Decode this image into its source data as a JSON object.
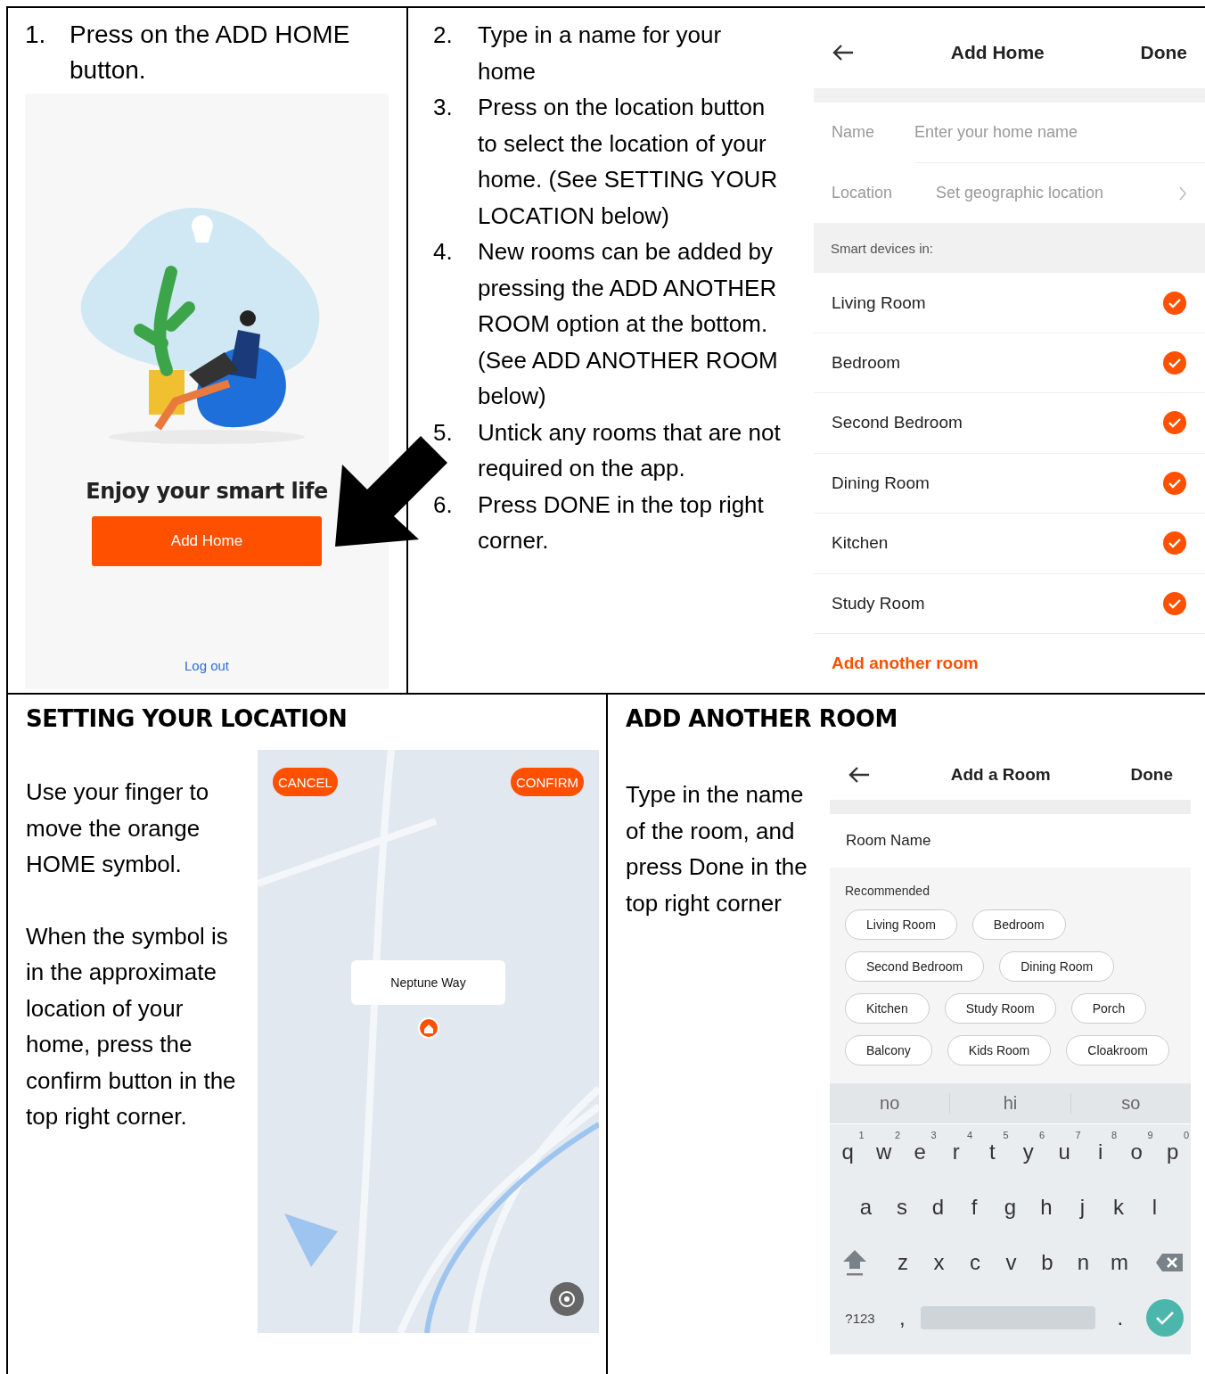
{
  "add_home_panel": {
    "step": {
      "number": "1.",
      "text": "Press on the ADD HOME button."
    },
    "screen": {
      "headline": "Enjoy your smart life",
      "button": "Add Home",
      "link": "Log out"
    }
  },
  "steps": [
    {
      "number": "2.",
      "text": "Type in a name for your home"
    },
    {
      "number": "3.",
      "text": "Press on the location button to select the location of your home.  (See SETTING YOUR LOCATION below)"
    },
    {
      "number": "4.",
      "text": "New rooms can be added by pressing the ADD ANOTHER ROOM option at the bottom. (See ADD ANOTHER ROOM below)"
    },
    {
      "number": "5.",
      "text": "Untick any rooms that are not required on the app."
    },
    {
      "number": "6.",
      "text": "Press DONE in the top right corner."
    }
  ],
  "add_home_screen": {
    "title": "Add Home",
    "action": "Done",
    "name_field": {
      "label": "Name",
      "placeholder": "Enter your home name"
    },
    "location_field": {
      "label": "Location",
      "value": "Set geographic location"
    },
    "section": "Smart devices in:",
    "rooms": [
      {
        "name": "Living Room",
        "checked": true
      },
      {
        "name": "Bedroom",
        "checked": true
      },
      {
        "name": "Second Bedroom",
        "checked": true
      },
      {
        "name": "Dining Room",
        "checked": true
      },
      {
        "name": "Kitchen",
        "checked": true
      },
      {
        "name": "Study Room",
        "checked": true
      }
    ],
    "add_link": "Add another room"
  },
  "location_section": {
    "heading": "SETTING YOUR LOCATION",
    "paragraphs": [
      "Use your finger to move the orange HOME symbol.",
      "When the symbol is in the approximate location of your home, press the confirm button in the top right corner."
    ],
    "map": {
      "cancel": "CANCEL",
      "confirm": "CONFIRM",
      "callout": "Neptune Way"
    }
  },
  "room_section": {
    "heading": "ADD ANOTHER ROOM",
    "paragraph": "Type in the name of the room, and press Done in the top right corner",
    "screen": {
      "title": "Add a Room",
      "action": "Done",
      "placeholder": "Room Name",
      "recommended_label": "Recommended",
      "chip_rows": [
        [
          "Living Room",
          "Bedroom"
        ],
        [
          "Second Bedroom",
          "Dining Room"
        ],
        [
          "Kitchen",
          "Study Room",
          "Porch"
        ],
        [
          "Balcony",
          "Kids Room",
          "Cloakroom"
        ]
      ],
      "keyboard": {
        "suggestions": [
          "no",
          "hi",
          "so"
        ],
        "rows": [
          [
            {
              "key": "q",
              "hint": "1"
            },
            {
              "key": "w",
              "hint": "2"
            },
            {
              "key": "e",
              "hint": "3"
            },
            {
              "key": "r",
              "hint": "4"
            },
            {
              "key": "t",
              "hint": "5"
            },
            {
              "key": "y",
              "hint": "6"
            },
            {
              "key": "u",
              "hint": "7"
            },
            {
              "key": "i",
              "hint": "8"
            },
            {
              "key": "o",
              "hint": "9"
            },
            {
              "key": "p",
              "hint": "0"
            }
          ],
          [
            {
              "key": "a"
            },
            {
              "key": "s"
            },
            {
              "key": "d"
            },
            {
              "key": "f"
            },
            {
              "key": "g"
            },
            {
              "key": "h"
            },
            {
              "key": "j"
            },
            {
              "key": "k"
            },
            {
              "key": "l"
            }
          ],
          [
            {
              "key": "z"
            },
            {
              "key": "x"
            },
            {
              "key": "c"
            },
            {
              "key": "v"
            },
            {
              "key": "b"
            },
            {
              "key": "n"
            },
            {
              "key": "m"
            }
          ]
        ],
        "symbols": "?123",
        "comma": ",",
        "period": "."
      }
    }
  }
}
